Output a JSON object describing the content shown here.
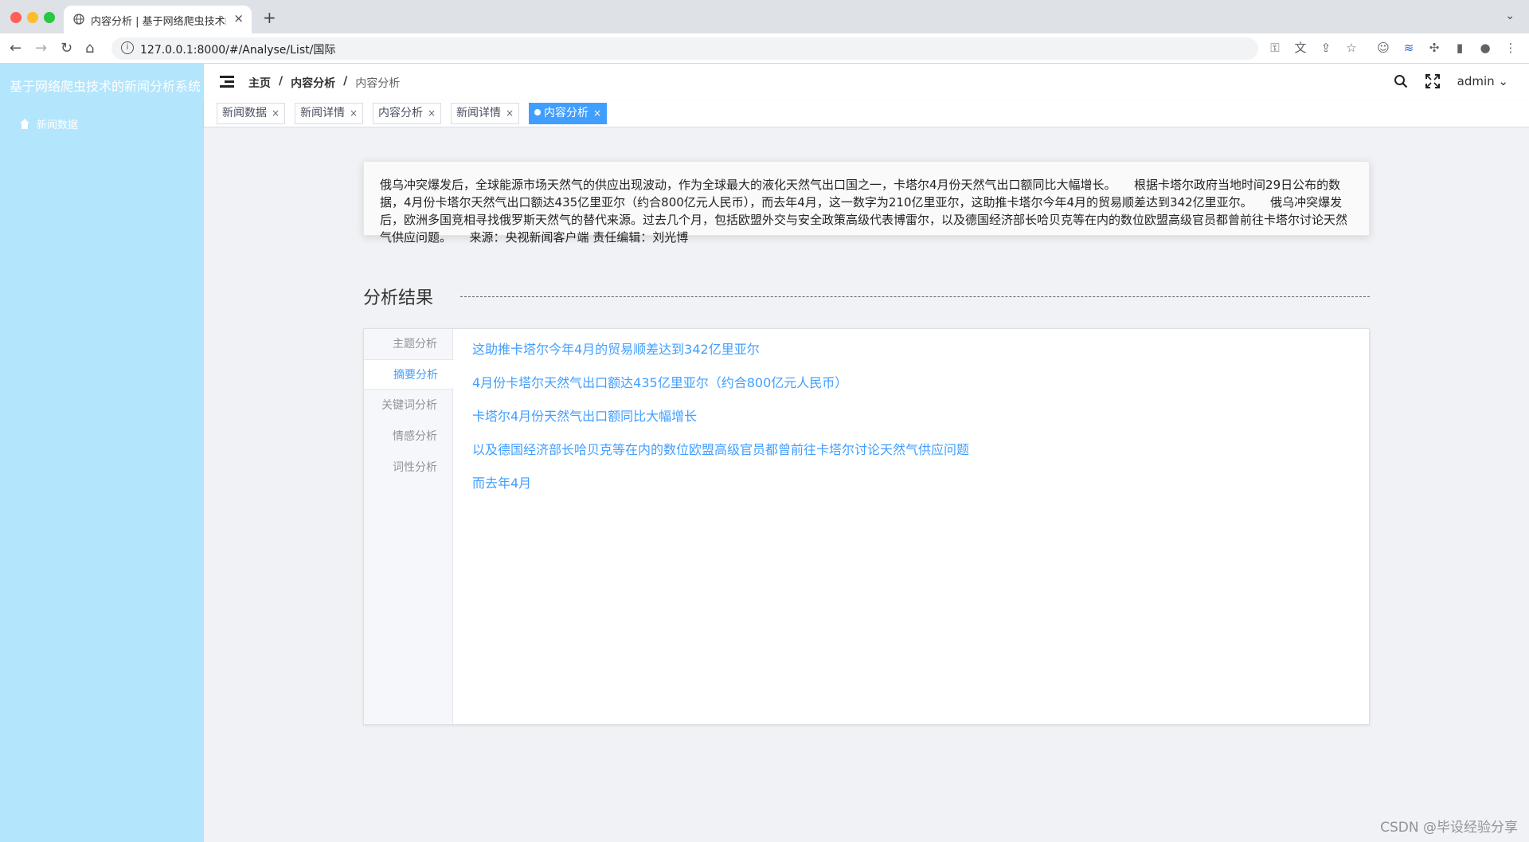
{
  "browser": {
    "tab_title": "内容分析 | 基于网络爬虫技术的新闻分析系统",
    "tab_close": "×",
    "new_tab": "+",
    "url": "127.0.0.1:8000/#/Analyse/List/国际"
  },
  "sidebar": {
    "brand": "基于网络爬虫技术的新闻分析系统",
    "items": [
      {
        "label": "新闻数据",
        "icon": "home-icon"
      }
    ]
  },
  "navbar": {
    "breadcrumb": [
      "主页",
      "内容分析",
      "内容分析"
    ],
    "separator": "/",
    "user": "admin"
  },
  "tags": [
    {
      "label": "新闻数据",
      "active": false
    },
    {
      "label": "新闻详情",
      "active": false
    },
    {
      "label": "内容分析",
      "active": false
    },
    {
      "label": "新闻详情",
      "active": false
    },
    {
      "label": "内容分析",
      "active": true
    }
  ],
  "tag_close": "×",
  "article": {
    "text": "俄乌冲突爆发后，全球能源市场天然气的供应出现波动，作为全球最大的液化天然气出口国之一，卡塔尔4月份天然气出口额同比大幅增长。　　根据卡塔尔政府当地时间29日公布的数据，4月份卡塔尔天然气出口额达435亿里亚尔（约合800亿元人民币），而去年4月，这一数字为210亿里亚尔，这助推卡塔尔今年4月的贸易顺差达到342亿里亚尔。　　俄乌冲突爆发后，欧洲多国竞相寻找俄罗斯天然气的替代来源。过去几个月，包括欧盟外交与安全政策高级代表博雷尔，以及德国经济部长哈贝克等在内的数位欧盟高级官员都曾前往卡塔尔讨论天然气供应问题。　　来源：央视新闻客户端 责任编辑：刘光博"
  },
  "analysis": {
    "title": "分析结果",
    "tabs": [
      {
        "label": "主题分析",
        "active": false
      },
      {
        "label": "摘要分析",
        "active": true
      },
      {
        "label": "关键词分析",
        "active": false
      },
      {
        "label": "情感分析",
        "active": false
      },
      {
        "label": "词性分析",
        "active": false
      }
    ],
    "summary": [
      "这助推卡塔尔今年4月的贸易顺差达到342亿里亚尔",
      "4月份卡塔尔天然气出口额达435亿里亚尔（约合800亿元人民币）",
      "卡塔尔4月份天然气出口额同比大幅增长",
      "以及德国经济部长哈贝克等在内的数位欧盟高级官员都曾前往卡塔尔讨论天然气供应问题",
      "而去年4月"
    ]
  },
  "footer_watermark": "CSDN @毕设经验分享",
  "colors": {
    "accent": "#409eff",
    "sidebar": "#b3e5fc"
  }
}
